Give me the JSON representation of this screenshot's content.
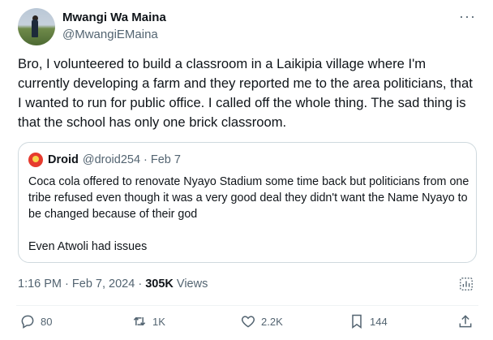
{
  "author": {
    "name": "Mwangi Wa Maina",
    "handle": "@MwangiEMaina",
    "more_icon": "more-horizontal-icon"
  },
  "tweet": {
    "text": "Bro, I volunteered to build a classroom in a Laikipia village where I'm currently developing a farm and they reported me to the area politicians, that I wanted to run for public office. I called off the whole thing. The sad thing is that the school has only one brick classroom."
  },
  "quote": {
    "name": "Droid",
    "handle": "@droid254",
    "separator": "·",
    "date": "Feb 7",
    "paragraph1": "Coca cola offered to renovate Nyayo Stadium some time back but politicians from one tribe refused even though it was a very good deal they didn't want the Name Nyayo to be changed because of their god",
    "paragraph2": "Even Atwoli had issues"
  },
  "meta": {
    "time": "1:16 PM",
    "separator": "·",
    "date": "Feb 7, 2024",
    "views_count": "305K",
    "views_label": "Views"
  },
  "actions": {
    "replies": "80",
    "reposts": "1K",
    "likes": "2.2K",
    "bookmarks": "144"
  },
  "colors": {
    "text": "#0f1419",
    "secondary": "#536471",
    "border": "#cfd9de"
  }
}
